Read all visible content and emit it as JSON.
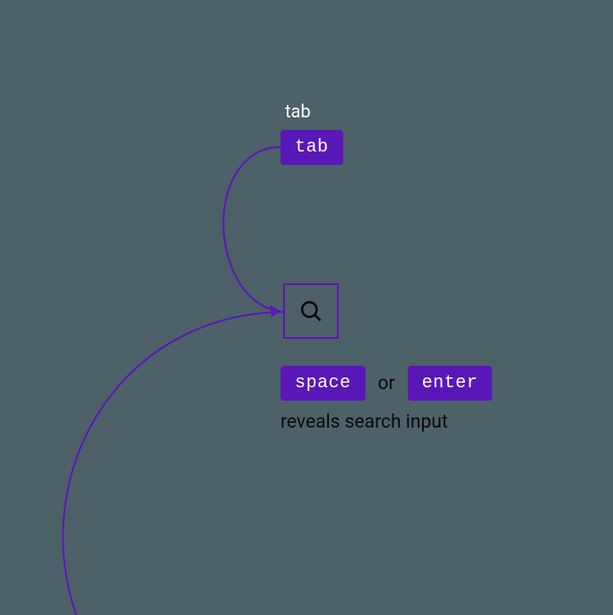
{
  "diagram": {
    "label_tab": "tab",
    "key_tab": "tab",
    "key_space": "space",
    "connector_or": "or",
    "key_enter": "enter",
    "result_text": "reveals search input"
  },
  "colors": {
    "background": "#4d6168",
    "accent": "#5a17b8",
    "text_light": "#ffffff",
    "text_dark": "#0a0a0a"
  }
}
